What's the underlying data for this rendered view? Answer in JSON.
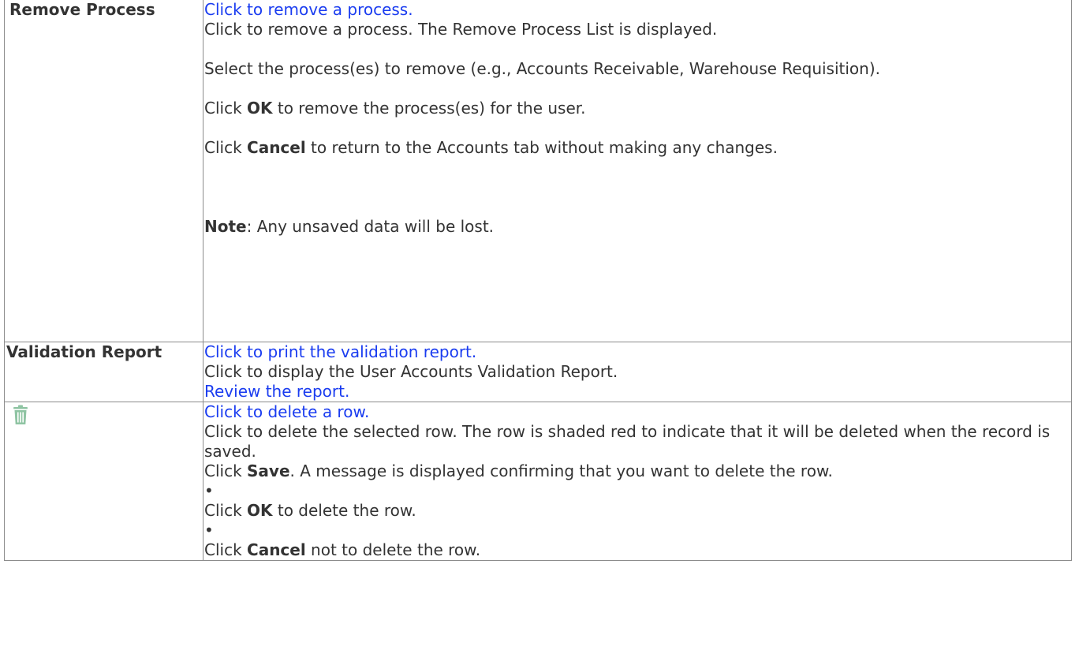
{
  "rows": [
    {
      "label": "Remove Process",
      "link": "Click to remove a process.",
      "text1": "Click to remove a process. The Remove Process List is displayed.",
      "text2": "Select the process(es) to remove (e.g., Accounts Receivable, Warehouse Requisition).",
      "ok_pre": "Click ",
      "ok_bold": "OK",
      "ok_post": " to remove the process(es) for the user.",
      "cancel_pre": "Click ",
      "cancel_bold": "Cancel",
      "cancel_post": " to return to the Accounts tab without making any changes.",
      "note_bold": "Note",
      "note_post": ": Any unsaved data will be lost."
    },
    {
      "label": "Validation Report",
      "link": "Click to print the validation report.",
      "text1": "Click to display the User Accounts Validation Report.",
      "link2": "Review the report."
    },
    {
      "icon": "trash-icon",
      "icon_color": "#8fc4a3",
      "link": "Click to delete a row.",
      "text1": "Click to delete the selected row. The row is shaded red to indicate that it will be deleted when the record is saved.",
      "save_pre": "Click ",
      "save_bold": "Save",
      "save_post": ". A message is displayed confirming that you want to delete the row.",
      "bullet": "•",
      "ok_pre": "Click ",
      "ok_bold": "OK",
      "ok_post": " to delete the row.",
      "cancel_pre": "Click ",
      "cancel_bold": "Cancel",
      "cancel_post": " not to delete the row."
    }
  ],
  "colors": {
    "link": "#1a3cf0",
    "text": "#333333",
    "border": "#8c8c8c"
  }
}
